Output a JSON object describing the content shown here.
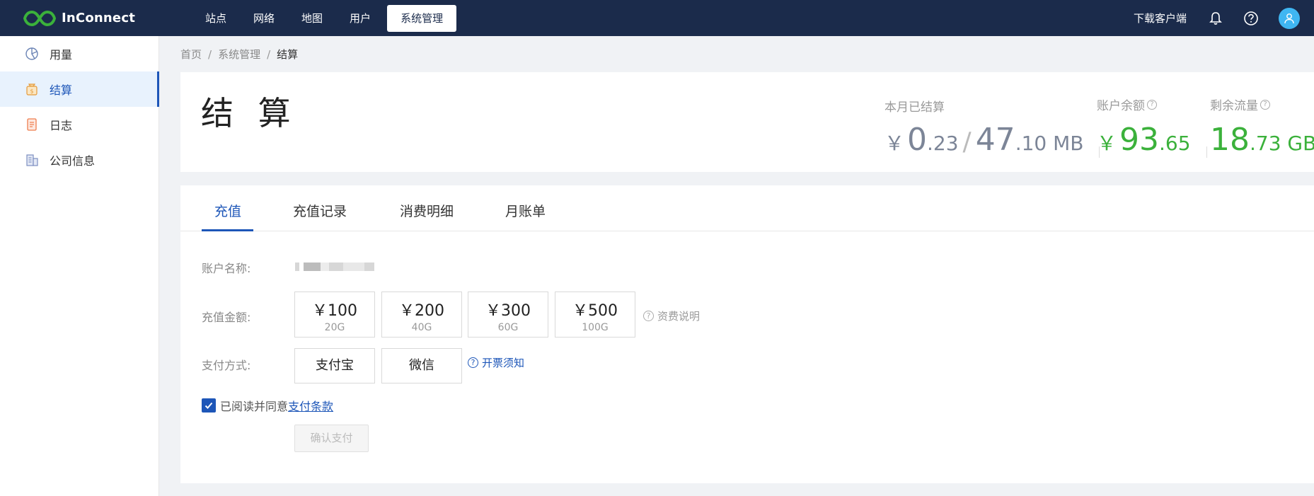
{
  "topbar": {
    "brand": "InConnect",
    "nav": [
      "站点",
      "网络",
      "地图",
      "用户",
      "系统管理"
    ],
    "active_nav": "系统管理",
    "download_label": "下载客户端"
  },
  "sidebar": {
    "items": [
      {
        "label": "用量",
        "icon": "pie-chart-icon"
      },
      {
        "label": "结算",
        "icon": "money-bag-icon",
        "active": true
      },
      {
        "label": "日志",
        "icon": "document-icon"
      },
      {
        "label": "公司信息",
        "icon": "building-icon"
      }
    ]
  },
  "breadcrumb": {
    "home": "首页",
    "section": "系统管理",
    "current": "结算"
  },
  "header": {
    "title": "结 算",
    "settled": {
      "label": "本月已结算",
      "currency": "￥",
      "amount_int": "0",
      "amount_dec": ".23",
      "slash": "/",
      "traffic_int": "47",
      "traffic_dec": ".10 MB"
    },
    "balance": {
      "label": "账户余额",
      "currency": "￥",
      "int": "93",
      "dec": ".65"
    },
    "remaining": {
      "label": "剩余流量",
      "int": "18",
      "dec": ".73 GB"
    }
  },
  "tabs": [
    "充值",
    "充值记录",
    "消费明细",
    "月账单"
  ],
  "form": {
    "account_label": "账户名称:",
    "amount_label": "充值金额:",
    "payment_label": "支付方式:",
    "amounts": [
      {
        "value": "￥100",
        "data": "20G"
      },
      {
        "value": "￥200",
        "data": "40G"
      },
      {
        "value": "￥300",
        "data": "60G"
      },
      {
        "value": "￥500",
        "data": "100G"
      }
    ],
    "fee_help": "资费说明",
    "payments": [
      "支付宝",
      "微信"
    ],
    "invoice_help": "开票须知",
    "agree_text": "已阅读并同意",
    "agree_link": "支付条款",
    "agree_checked": true,
    "confirm_label": "确认支付"
  },
  "colors": {
    "navbar": "#1b2b4b",
    "accent": "#1d56b8",
    "green": "#3bb13b",
    "avatar": "#3fb6f2"
  }
}
